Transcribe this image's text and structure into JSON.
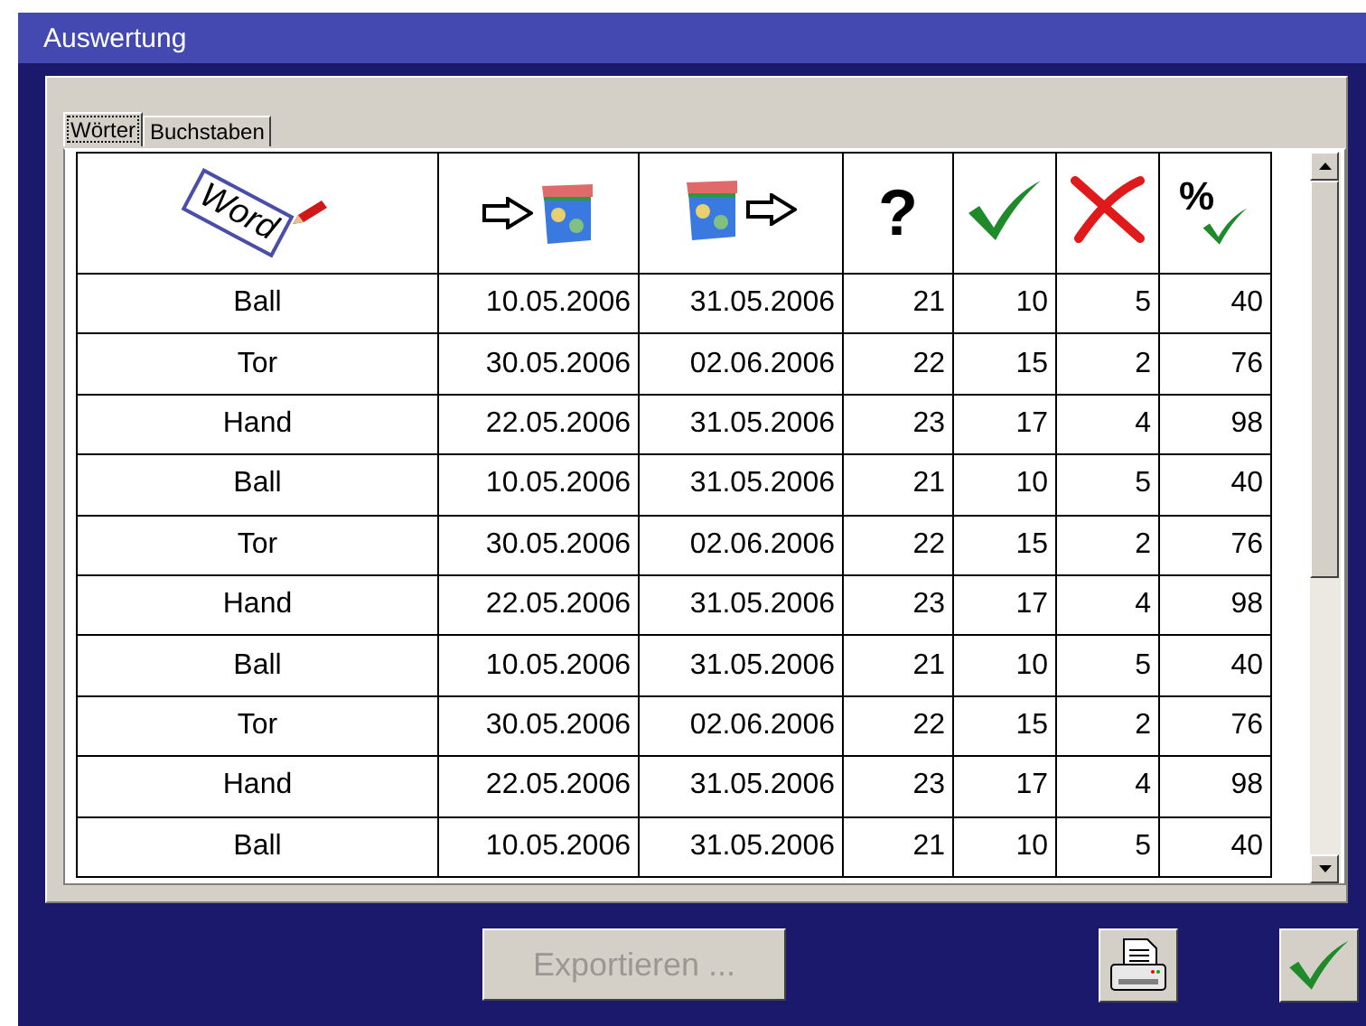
{
  "window": {
    "title": "Auswertung"
  },
  "tabs": [
    {
      "label": "Wörter",
      "selected": true
    },
    {
      "label": "Buchstaben",
      "selected": false
    }
  ],
  "table": {
    "columns": [
      {
        "kind": "word",
        "label": "Word"
      },
      {
        "kind": "in"
      },
      {
        "kind": "out"
      },
      {
        "kind": "text",
        "label": "?"
      },
      {
        "kind": "check"
      },
      {
        "kind": "cross"
      },
      {
        "kind": "percent",
        "label": "%"
      }
    ],
    "rows": [
      [
        "Ball",
        "10.05.2006",
        "31.05.2006",
        "21",
        "10",
        "5",
        "40"
      ],
      [
        "Tor",
        "30.05.2006",
        "02.06.2006",
        "22",
        "15",
        "2",
        "76"
      ],
      [
        "Hand",
        "22.05.2006",
        "31.05.2006",
        "23",
        "17",
        "4",
        "98"
      ],
      [
        "Ball",
        "10.05.2006",
        "31.05.2006",
        "21",
        "10",
        "5",
        "40"
      ],
      [
        "Tor",
        "30.05.2006",
        "02.06.2006",
        "22",
        "15",
        "2",
        "76"
      ],
      [
        "Hand",
        "22.05.2006",
        "31.05.2006",
        "23",
        "17",
        "4",
        "98"
      ],
      [
        "Ball",
        "10.05.2006",
        "31.05.2006",
        "21",
        "10",
        "5",
        "40"
      ],
      [
        "Tor",
        "30.05.2006",
        "02.06.2006",
        "22",
        "15",
        "2",
        "76"
      ],
      [
        "Hand",
        "22.05.2006",
        "31.05.2006",
        "23",
        "17",
        "4",
        "98"
      ],
      [
        "Ball",
        "10.05.2006",
        "31.05.2006",
        "21",
        "10",
        "5",
        "40"
      ]
    ]
  },
  "export_button": {
    "label": "Exportieren ...",
    "disabled": true
  }
}
